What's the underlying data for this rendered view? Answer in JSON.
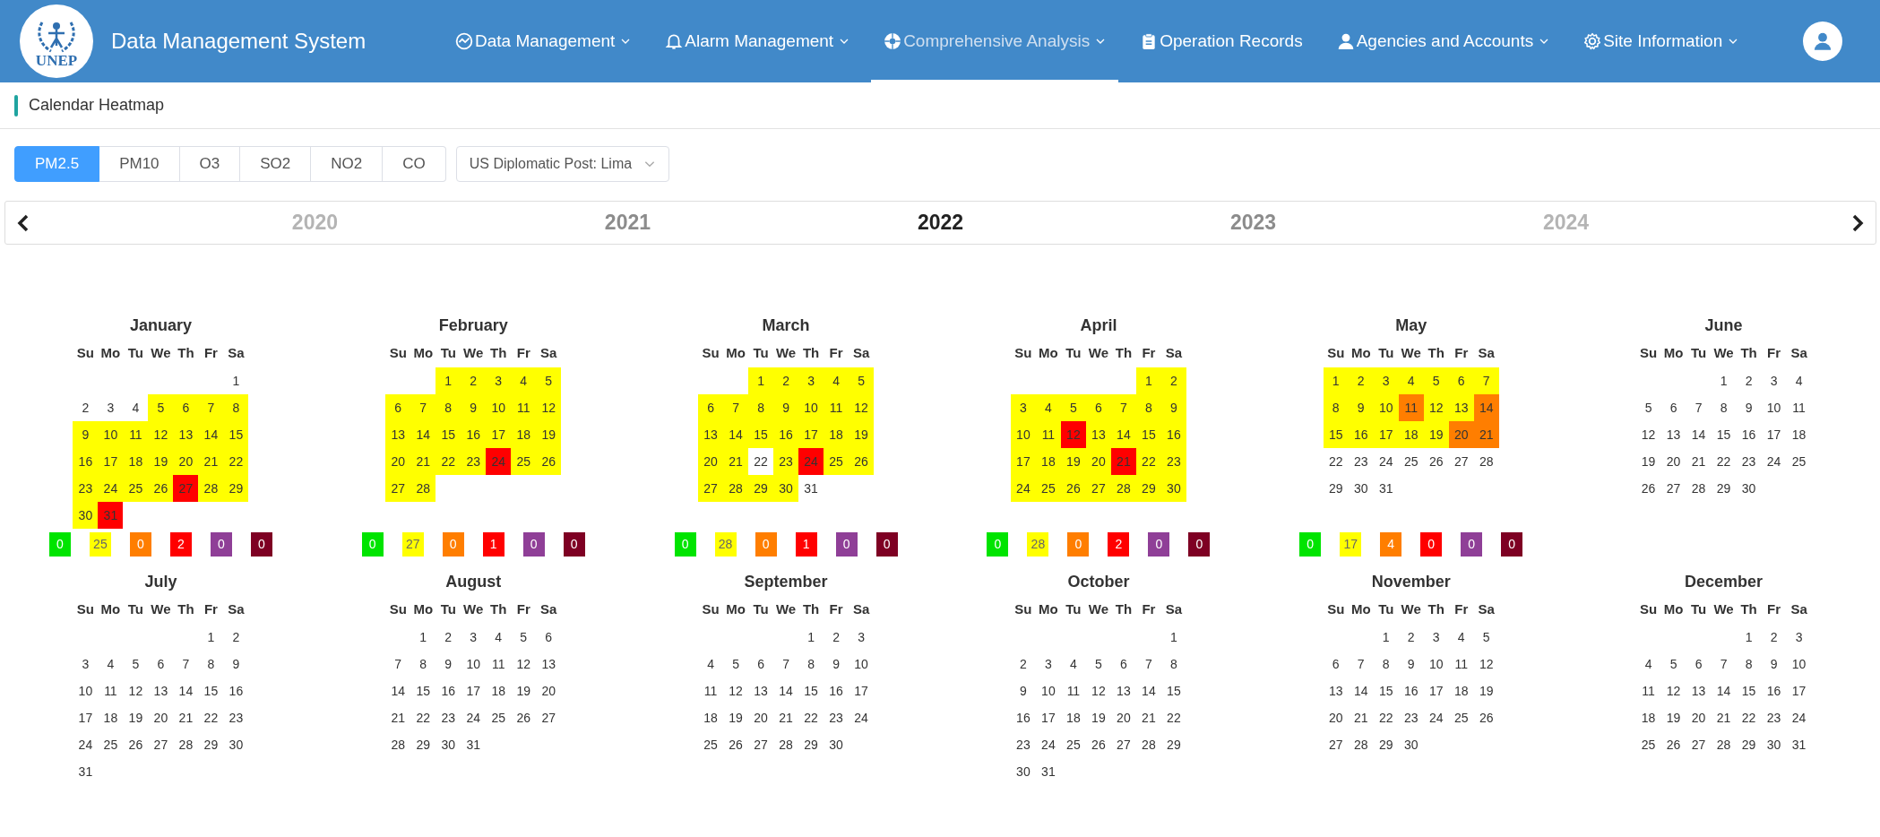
{
  "header": {
    "logo_text": "UNEP",
    "title": "Data Management System",
    "nav": [
      {
        "label": "Data Management",
        "has_menu": true,
        "selected": false
      },
      {
        "label": "Alarm Management",
        "has_menu": true,
        "selected": false
      },
      {
        "label": "Comprehensive Analysis",
        "has_menu": true,
        "selected": true
      },
      {
        "label": "Operation Records",
        "has_menu": false,
        "selected": false
      },
      {
        "label": "Agencies and Accounts",
        "has_menu": true,
        "selected": false
      },
      {
        "label": "Site Information",
        "has_menu": true,
        "selected": false
      }
    ]
  },
  "page_title": "Calendar Heatmap",
  "pollutant_tabs": [
    {
      "label": "PM2.5",
      "selected": true
    },
    {
      "label": "PM10",
      "selected": false
    },
    {
      "label": "O3",
      "selected": false
    },
    {
      "label": "SO2",
      "selected": false
    },
    {
      "label": "NO2",
      "selected": false
    },
    {
      "label": "CO",
      "selected": false
    }
  ],
  "station_select": {
    "value": "US Diplomatic Post: Lima"
  },
  "years": [
    {
      "label": "2020",
      "selected": false
    },
    {
      "label": "2021",
      "selected": false
    },
    {
      "label": "2022",
      "selected": true
    },
    {
      "label": "2023",
      "selected": false
    },
    {
      "label": "2024",
      "selected": false
    }
  ],
  "months": [
    {
      "name": "January",
      "weekdays": [
        "Su",
        "Mo",
        "Tu",
        "We",
        "Th",
        "Fr",
        "Sa"
      ],
      "weeks": [
        [
          {
            "day": "1"
          }
        ],
        [
          {
            "day": "2"
          },
          {
            "day": "3"
          },
          {
            "day": "4"
          },
          {
            "day": "5",
            "color": "#ffff00"
          },
          {
            "day": "6",
            "color": "#ffff00"
          },
          {
            "day": "7",
            "color": "#ffff00"
          },
          {
            "day": "8",
            "color": "#ffff00"
          }
        ],
        [
          {
            "day": "9",
            "color": "#ffff00"
          },
          {
            "day": "10",
            "color": "#ffff00"
          },
          {
            "day": "11",
            "color": "#ffff00"
          },
          {
            "day": "12",
            "color": "#ffff00"
          },
          {
            "day": "13",
            "color": "#ffff00"
          },
          {
            "day": "14",
            "color": "#ffff00"
          },
          {
            "day": "15",
            "color": "#ffff00"
          }
        ],
        [
          {
            "day": "16",
            "color": "#ffff00"
          },
          {
            "day": "17",
            "color": "#ffff00"
          },
          {
            "day": "18",
            "color": "#ffff00"
          },
          {
            "day": "19",
            "color": "#ffff00"
          },
          {
            "day": "20",
            "color": "#ffff00"
          },
          {
            "day": "21",
            "color": "#ffff00"
          },
          {
            "day": "22",
            "color": "#ffff00"
          }
        ],
        [
          {
            "day": "23",
            "color": "#ffff00"
          },
          {
            "day": "24",
            "color": "#ffff00"
          },
          {
            "day": "25",
            "color": "#ffff00"
          },
          {
            "day": "26",
            "color": "#ffff00"
          },
          {
            "day": "27",
            "color": "#ff0000"
          },
          {
            "day": "28",
            "color": "#ffff00"
          },
          {
            "day": "29",
            "color": "#ffff00"
          }
        ],
        [
          {
            "day": "30",
            "color": "#ffff00"
          },
          {
            "day": "31",
            "color": "#ff0000"
          }
        ]
      ],
      "legend": [
        {
          "count": "0",
          "color": "#00e400"
        },
        {
          "count": "25",
          "color": "#ffff00"
        },
        {
          "count": "0",
          "color": "#ff7e00"
        },
        {
          "count": "2",
          "color": "#ff0000"
        },
        {
          "count": "0",
          "color": "#8f3f97"
        },
        {
          "count": "0",
          "color": "#7e0023"
        }
      ]
    },
    {
      "name": "February",
      "weekdays": [
        "Su",
        "Mo",
        "Tu",
        "We",
        "Th",
        "Fr",
        "Sa"
      ],
      "weeks": [
        [
          {
            "day": "1",
            "color": "#ffff00"
          },
          {
            "day": "2",
            "color": "#ffff00"
          },
          {
            "day": "3",
            "color": "#ffff00"
          },
          {
            "day": "4",
            "color": "#ffff00"
          },
          {
            "day": "5",
            "color": "#ffff00"
          }
        ],
        [
          {
            "day": "6",
            "color": "#ffff00"
          },
          {
            "day": "7",
            "color": "#ffff00"
          },
          {
            "day": "8",
            "color": "#ffff00"
          },
          {
            "day": "9",
            "color": "#ffff00"
          },
          {
            "day": "10",
            "color": "#ffff00"
          },
          {
            "day": "11",
            "color": "#ffff00"
          },
          {
            "day": "12",
            "color": "#ffff00"
          }
        ],
        [
          {
            "day": "13",
            "color": "#ffff00"
          },
          {
            "day": "14",
            "color": "#ffff00"
          },
          {
            "day": "15",
            "color": "#ffff00"
          },
          {
            "day": "16",
            "color": "#ffff00"
          },
          {
            "day": "17",
            "color": "#ffff00"
          },
          {
            "day": "18",
            "color": "#ffff00"
          },
          {
            "day": "19",
            "color": "#ffff00"
          }
        ],
        [
          {
            "day": "20",
            "color": "#ffff00"
          },
          {
            "day": "21",
            "color": "#ffff00"
          },
          {
            "day": "22",
            "color": "#ffff00"
          },
          {
            "day": "23",
            "color": "#ffff00"
          },
          {
            "day": "24",
            "color": "#ff0000"
          },
          {
            "day": "25",
            "color": "#ffff00"
          },
          {
            "day": "26",
            "color": "#ffff00"
          }
        ],
        [
          {
            "day": "27",
            "color": "#ffff00"
          },
          {
            "day": "28",
            "color": "#ffff00"
          }
        ]
      ],
      "legend": [
        {
          "count": "0",
          "color": "#00e400"
        },
        {
          "count": "27",
          "color": "#ffff00"
        },
        {
          "count": "0",
          "color": "#ff7e00"
        },
        {
          "count": "1",
          "color": "#ff0000"
        },
        {
          "count": "0",
          "color": "#8f3f97"
        },
        {
          "count": "0",
          "color": "#7e0023"
        }
      ]
    },
    {
      "name": "March",
      "weekdays": [
        "Su",
        "Mo",
        "Tu",
        "We",
        "Th",
        "Fr",
        "Sa"
      ],
      "weeks": [
        [
          {
            "day": "1",
            "color": "#ffff00"
          },
          {
            "day": "2",
            "color": "#ffff00"
          },
          {
            "day": "3",
            "color": "#ffff00"
          },
          {
            "day": "4",
            "color": "#ffff00"
          },
          {
            "day": "5",
            "color": "#ffff00"
          }
        ],
        [
          {
            "day": "6",
            "color": "#ffff00"
          },
          {
            "day": "7",
            "color": "#ffff00"
          },
          {
            "day": "8",
            "color": "#ffff00"
          },
          {
            "day": "9",
            "color": "#ffff00"
          },
          {
            "day": "10",
            "color": "#ffff00"
          },
          {
            "day": "11",
            "color": "#ffff00"
          },
          {
            "day": "12",
            "color": "#ffff00"
          }
        ],
        [
          {
            "day": "13",
            "color": "#ffff00"
          },
          {
            "day": "14",
            "color": "#ffff00"
          },
          {
            "day": "15",
            "color": "#ffff00"
          },
          {
            "day": "16",
            "color": "#ffff00"
          },
          {
            "day": "17",
            "color": "#ffff00"
          },
          {
            "day": "18",
            "color": "#ffff00"
          },
          {
            "day": "19",
            "color": "#ffff00"
          }
        ],
        [
          {
            "day": "20",
            "color": "#ffff00"
          },
          {
            "day": "21",
            "color": "#ffff00"
          },
          {
            "day": "22"
          },
          {
            "day": "23",
            "color": "#ffff00"
          },
          {
            "day": "24",
            "color": "#ff0000"
          },
          {
            "day": "25",
            "color": "#ffff00"
          },
          {
            "day": "26",
            "color": "#ffff00"
          }
        ],
        [
          {
            "day": "27",
            "color": "#ffff00"
          },
          {
            "day": "28",
            "color": "#ffff00"
          },
          {
            "day": "29",
            "color": "#ffff00"
          },
          {
            "day": "30",
            "color": "#ffff00"
          },
          {
            "day": "31"
          }
        ]
      ],
      "legend": [
        {
          "count": "0",
          "color": "#00e400"
        },
        {
          "count": "28",
          "color": "#ffff00"
        },
        {
          "count": "0",
          "color": "#ff7e00"
        },
        {
          "count": "1",
          "color": "#ff0000"
        },
        {
          "count": "0",
          "color": "#8f3f97"
        },
        {
          "count": "0",
          "color": "#7e0023"
        }
      ]
    },
    {
      "name": "April",
      "weekdays": [
        "Su",
        "Mo",
        "Tu",
        "We",
        "Th",
        "Fr",
        "Sa"
      ],
      "weeks": [
        [
          {
            "day": "1",
            "color": "#ffff00"
          },
          {
            "day": "2",
            "color": "#ffff00"
          }
        ],
        [
          {
            "day": "3",
            "color": "#ffff00"
          },
          {
            "day": "4",
            "color": "#ffff00"
          },
          {
            "day": "5",
            "color": "#ffff00"
          },
          {
            "day": "6",
            "color": "#ffff00"
          },
          {
            "day": "7",
            "color": "#ffff00"
          },
          {
            "day": "8",
            "color": "#ffff00"
          },
          {
            "day": "9",
            "color": "#ffff00"
          }
        ],
        [
          {
            "day": "10",
            "color": "#ffff00"
          },
          {
            "day": "11",
            "color": "#ffff00"
          },
          {
            "day": "12",
            "color": "#ff0000"
          },
          {
            "day": "13",
            "color": "#ffff00"
          },
          {
            "day": "14",
            "color": "#ffff00"
          },
          {
            "day": "15",
            "color": "#ffff00"
          },
          {
            "day": "16",
            "color": "#ffff00"
          }
        ],
        [
          {
            "day": "17",
            "color": "#ffff00"
          },
          {
            "day": "18",
            "color": "#ffff00"
          },
          {
            "day": "19",
            "color": "#ffff00"
          },
          {
            "day": "20",
            "color": "#ffff00"
          },
          {
            "day": "21",
            "color": "#ff0000"
          },
          {
            "day": "22",
            "color": "#ffff00"
          },
          {
            "day": "23",
            "color": "#ffff00"
          }
        ],
        [
          {
            "day": "24",
            "color": "#ffff00"
          },
          {
            "day": "25",
            "color": "#ffff00"
          },
          {
            "day": "26",
            "color": "#ffff00"
          },
          {
            "day": "27",
            "color": "#ffff00"
          },
          {
            "day": "28",
            "color": "#ffff00"
          },
          {
            "day": "29",
            "color": "#ffff00"
          },
          {
            "day": "30",
            "color": "#ffff00"
          }
        ]
      ],
      "legend": [
        {
          "count": "0",
          "color": "#00e400"
        },
        {
          "count": "28",
          "color": "#ffff00"
        },
        {
          "count": "0",
          "color": "#ff7e00"
        },
        {
          "count": "2",
          "color": "#ff0000"
        },
        {
          "count": "0",
          "color": "#8f3f97"
        },
        {
          "count": "0",
          "color": "#7e0023"
        }
      ]
    },
    {
      "name": "May",
      "weekdays": [
        "Su",
        "Mo",
        "Tu",
        "We",
        "Th",
        "Fr",
        "Sa"
      ],
      "weeks": [
        [
          {
            "day": "1",
            "color": "#ffff00"
          },
          {
            "day": "2",
            "color": "#ffff00"
          },
          {
            "day": "3",
            "color": "#ffff00"
          },
          {
            "day": "4",
            "color": "#ffff00"
          },
          {
            "day": "5",
            "color": "#ffff00"
          },
          {
            "day": "6",
            "color": "#ffff00"
          },
          {
            "day": "7",
            "color": "#ffff00"
          }
        ],
        [
          {
            "day": "8",
            "color": "#ffff00"
          },
          {
            "day": "9",
            "color": "#ffff00"
          },
          {
            "day": "10",
            "color": "#ffff00"
          },
          {
            "day": "11",
            "color": "#ff7e00"
          },
          {
            "day": "12",
            "color": "#ffff00"
          },
          {
            "day": "13",
            "color": "#ffff00"
          },
          {
            "day": "14",
            "color": "#ff7e00"
          }
        ],
        [
          {
            "day": "15",
            "color": "#ffff00"
          },
          {
            "day": "16",
            "color": "#ffff00"
          },
          {
            "day": "17",
            "color": "#ffff00"
          },
          {
            "day": "18",
            "color": "#ffff00"
          },
          {
            "day": "19",
            "color": "#ffff00"
          },
          {
            "day": "20",
            "color": "#ff7e00"
          },
          {
            "day": "21",
            "color": "#ff7e00"
          }
        ],
        [
          {
            "day": "22"
          },
          {
            "day": "23"
          },
          {
            "day": "24"
          },
          {
            "day": "25"
          },
          {
            "day": "26"
          },
          {
            "day": "27"
          },
          {
            "day": "28"
          }
        ],
        [
          {
            "day": "29"
          },
          {
            "day": "30"
          },
          {
            "day": "31"
          }
        ]
      ],
      "legend": [
        {
          "count": "0",
          "color": "#00e400"
        },
        {
          "count": "17",
          "color": "#ffff00"
        },
        {
          "count": "4",
          "color": "#ff7e00"
        },
        {
          "count": "0",
          "color": "#ff0000"
        },
        {
          "count": "0",
          "color": "#8f3f97"
        },
        {
          "count": "0",
          "color": "#7e0023"
        }
      ]
    },
    {
      "name": "June",
      "weekdays": [
        "Su",
        "Mo",
        "Tu",
        "We",
        "Th",
        "Fr",
        "Sa"
      ],
      "weeks": [
        [
          {
            "day": "1"
          },
          {
            "day": "2"
          },
          {
            "day": "3"
          },
          {
            "day": "4"
          }
        ],
        [
          {
            "day": "5"
          },
          {
            "day": "6"
          },
          {
            "day": "7"
          },
          {
            "day": "8"
          },
          {
            "day": "9"
          },
          {
            "day": "10"
          },
          {
            "day": "11"
          }
        ],
        [
          {
            "day": "12"
          },
          {
            "day": "13"
          },
          {
            "day": "14"
          },
          {
            "day": "15"
          },
          {
            "day": "16"
          },
          {
            "day": "17"
          },
          {
            "day": "18"
          }
        ],
        [
          {
            "day": "19"
          },
          {
            "day": "20"
          },
          {
            "day": "21"
          },
          {
            "day": "22"
          },
          {
            "day": "23"
          },
          {
            "day": "24"
          },
          {
            "day": "25"
          }
        ],
        [
          {
            "day": "26"
          },
          {
            "day": "27"
          },
          {
            "day": "28"
          },
          {
            "day": "29"
          },
          {
            "day": "30"
          }
        ]
      ]
    },
    {
      "name": "July",
      "weekdays": [
        "Su",
        "Mo",
        "Tu",
        "We",
        "Th",
        "Fr",
        "Sa"
      ],
      "weeks": [
        [
          {
            "day": "1"
          },
          {
            "day": "2"
          }
        ],
        [
          {
            "day": "3"
          },
          {
            "day": "4"
          },
          {
            "day": "5"
          },
          {
            "day": "6"
          },
          {
            "day": "7"
          },
          {
            "day": "8"
          },
          {
            "day": "9"
          }
        ],
        [
          {
            "day": "10"
          },
          {
            "day": "11"
          },
          {
            "day": "12"
          },
          {
            "day": "13"
          },
          {
            "day": "14"
          },
          {
            "day": "15"
          },
          {
            "day": "16"
          }
        ],
        [
          {
            "day": "17"
          },
          {
            "day": "18"
          },
          {
            "day": "19"
          },
          {
            "day": "20"
          },
          {
            "day": "21"
          },
          {
            "day": "22"
          },
          {
            "day": "23"
          }
        ],
        [
          {
            "day": "24"
          },
          {
            "day": "25"
          },
          {
            "day": "26"
          },
          {
            "day": "27"
          },
          {
            "day": "28"
          },
          {
            "day": "29"
          },
          {
            "day": "30"
          }
        ],
        [
          {
            "day": "31"
          }
        ]
      ]
    },
    {
      "name": "August",
      "weekdays": [
        "Su",
        "Mo",
        "Tu",
        "We",
        "Th",
        "Fr",
        "Sa"
      ],
      "weeks": [
        [
          {
            "day": "1"
          },
          {
            "day": "2"
          },
          {
            "day": "3"
          },
          {
            "day": "4"
          },
          {
            "day": "5"
          },
          {
            "day": "6"
          }
        ],
        [
          {
            "day": "7"
          },
          {
            "day": "8"
          },
          {
            "day": "9"
          },
          {
            "day": "10"
          },
          {
            "day": "11"
          },
          {
            "day": "12"
          },
          {
            "day": "13"
          }
        ],
        [
          {
            "day": "14"
          },
          {
            "day": "15"
          },
          {
            "day": "16"
          },
          {
            "day": "17"
          },
          {
            "day": "18"
          },
          {
            "day": "19"
          },
          {
            "day": "20"
          }
        ],
        [
          {
            "day": "21"
          },
          {
            "day": "22"
          },
          {
            "day": "23"
          },
          {
            "day": "24"
          },
          {
            "day": "25"
          },
          {
            "day": "26"
          },
          {
            "day": "27"
          }
        ],
        [
          {
            "day": "28"
          },
          {
            "day": "29"
          },
          {
            "day": "30"
          },
          {
            "day": "31"
          }
        ]
      ]
    },
    {
      "name": "September",
      "weekdays": [
        "Su",
        "Mo",
        "Tu",
        "We",
        "Th",
        "Fr",
        "Sa"
      ],
      "weeks": [
        [
          {
            "day": "1"
          },
          {
            "day": "2"
          },
          {
            "day": "3"
          }
        ],
        [
          {
            "day": "4"
          },
          {
            "day": "5"
          },
          {
            "day": "6"
          },
          {
            "day": "7"
          },
          {
            "day": "8"
          },
          {
            "day": "9"
          },
          {
            "day": "10"
          }
        ],
        [
          {
            "day": "11"
          },
          {
            "day": "12"
          },
          {
            "day": "13"
          },
          {
            "day": "14"
          },
          {
            "day": "15"
          },
          {
            "day": "16"
          },
          {
            "day": "17"
          }
        ],
        [
          {
            "day": "18"
          },
          {
            "day": "19"
          },
          {
            "day": "20"
          },
          {
            "day": "21"
          },
          {
            "day": "22"
          },
          {
            "day": "23"
          },
          {
            "day": "24"
          }
        ],
        [
          {
            "day": "25"
          },
          {
            "day": "26"
          },
          {
            "day": "27"
          },
          {
            "day": "28"
          },
          {
            "day": "29"
          },
          {
            "day": "30"
          }
        ]
      ]
    },
    {
      "name": "October",
      "weekdays": [
        "Su",
        "Mo",
        "Tu",
        "We",
        "Th",
        "Fr",
        "Sa"
      ],
      "weeks": [
        [
          {
            "day": "1"
          }
        ],
        [
          {
            "day": "2"
          },
          {
            "day": "3"
          },
          {
            "day": "4"
          },
          {
            "day": "5"
          },
          {
            "day": "6"
          },
          {
            "day": "7"
          },
          {
            "day": "8"
          }
        ],
        [
          {
            "day": "9"
          },
          {
            "day": "10"
          },
          {
            "day": "11"
          },
          {
            "day": "12"
          },
          {
            "day": "13"
          },
          {
            "day": "14"
          },
          {
            "day": "15"
          }
        ],
        [
          {
            "day": "16"
          },
          {
            "day": "17"
          },
          {
            "day": "18"
          },
          {
            "day": "19"
          },
          {
            "day": "20"
          },
          {
            "day": "21"
          },
          {
            "day": "22"
          }
        ],
        [
          {
            "day": "23"
          },
          {
            "day": "24"
          },
          {
            "day": "25"
          },
          {
            "day": "26"
          },
          {
            "day": "27"
          },
          {
            "day": "28"
          },
          {
            "day": "29"
          }
        ],
        [
          {
            "day": "30"
          },
          {
            "day": "31"
          }
        ]
      ]
    },
    {
      "name": "November",
      "weekdays": [
        "Su",
        "Mo",
        "Tu",
        "We",
        "Th",
        "Fr",
        "Sa"
      ],
      "weeks": [
        [
          {
            "day": "1"
          },
          {
            "day": "2"
          },
          {
            "day": "3"
          },
          {
            "day": "4"
          },
          {
            "day": "5"
          }
        ],
        [
          {
            "day": "6"
          },
          {
            "day": "7"
          },
          {
            "day": "8"
          },
          {
            "day": "9"
          },
          {
            "day": "10"
          },
          {
            "day": "11"
          },
          {
            "day": "12"
          }
        ],
        [
          {
            "day": "13"
          },
          {
            "day": "14"
          },
          {
            "day": "15"
          },
          {
            "day": "16"
          },
          {
            "day": "17"
          },
          {
            "day": "18"
          },
          {
            "day": "19"
          }
        ],
        [
          {
            "day": "20"
          },
          {
            "day": "21"
          },
          {
            "day": "22"
          },
          {
            "day": "23"
          },
          {
            "day": "24"
          },
          {
            "day": "25"
          },
          {
            "day": "26"
          }
        ],
        [
          {
            "day": "27"
          },
          {
            "day": "28"
          },
          {
            "day": "29"
          },
          {
            "day": "30"
          }
        ]
      ]
    },
    {
      "name": "December",
      "weekdays": [
        "Su",
        "Mo",
        "Tu",
        "We",
        "Th",
        "Fr",
        "Sa"
      ],
      "weeks": [
        [
          {
            "day": "1"
          },
          {
            "day": "2"
          },
          {
            "day": "3"
          }
        ],
        [
          {
            "day": "4"
          },
          {
            "day": "5"
          },
          {
            "day": "6"
          },
          {
            "day": "7"
          },
          {
            "day": "8"
          },
          {
            "day": "9"
          },
          {
            "day": "10"
          }
        ],
        [
          {
            "day": "11"
          },
          {
            "day": "12"
          },
          {
            "day": "13"
          },
          {
            "day": "14"
          },
          {
            "day": "15"
          },
          {
            "day": "16"
          },
          {
            "day": "17"
          }
        ],
        [
          {
            "day": "18"
          },
          {
            "day": "19"
          },
          {
            "day": "20"
          },
          {
            "day": "21"
          },
          {
            "day": "22"
          },
          {
            "day": "23"
          },
          {
            "day": "24"
          }
        ],
        [
          {
            "day": "25"
          },
          {
            "day": "26"
          },
          {
            "day": "27"
          },
          {
            "day": "28"
          },
          {
            "day": "29"
          },
          {
            "day": "30"
          },
          {
            "day": "31"
          }
        ]
      ]
    }
  ]
}
